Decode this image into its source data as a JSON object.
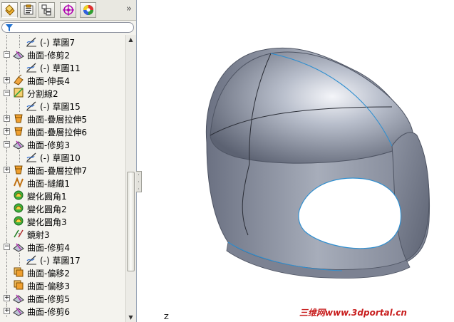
{
  "tabs": [
    {
      "name": "feature-manager-tab-icon",
      "active": true
    },
    {
      "name": "property-manager-tab-icon",
      "active": false
    },
    {
      "name": "configuration-manager-tab-icon",
      "active": false
    },
    {
      "name": "dim-xpert-tab-icon",
      "active": false
    },
    {
      "name": "display-manager-tab-icon",
      "active": false
    }
  ],
  "more_tabs_glyph": "»",
  "filter_icon": "filter-icon",
  "tree": {
    "items": [
      {
        "label": "(-) 草圖7",
        "indent": 2,
        "icon": "sketch-icon",
        "expander": ""
      },
      {
        "label": "曲面-修剪2",
        "indent": 1,
        "icon": "surface-trim-icon",
        "expander": "−"
      },
      {
        "label": "(-) 草圖11",
        "indent": 2,
        "icon": "sketch-icon",
        "expander": ""
      },
      {
        "label": "曲面-伸長4",
        "indent": 1,
        "icon": "surface-extend-icon",
        "expander": "+"
      },
      {
        "label": "分割線2",
        "indent": 1,
        "icon": "split-line-icon",
        "expander": "−"
      },
      {
        "label": "(-) 草圖15",
        "indent": 2,
        "icon": "sketch-icon",
        "expander": ""
      },
      {
        "label": "曲面-疊層拉伸5",
        "indent": 1,
        "icon": "surface-loft-icon",
        "expander": "+"
      },
      {
        "label": "曲面-疊層拉伸6",
        "indent": 1,
        "icon": "surface-loft-icon",
        "expander": "+"
      },
      {
        "label": "曲面-修剪3",
        "indent": 1,
        "icon": "surface-trim-icon",
        "expander": "−"
      },
      {
        "label": "(-) 草圖10",
        "indent": 2,
        "icon": "sketch-icon",
        "expander": ""
      },
      {
        "label": "曲面-疊層拉伸7",
        "indent": 1,
        "icon": "surface-loft-icon",
        "expander": "+"
      },
      {
        "label": "曲面-縫織1",
        "indent": 1,
        "icon": "surface-knit-icon",
        "expander": ""
      },
      {
        "label": "變化圓角1",
        "indent": 1,
        "icon": "variable-fillet-icon",
        "expander": ""
      },
      {
        "label": "變化圓角2",
        "indent": 1,
        "icon": "variable-fillet-icon",
        "expander": ""
      },
      {
        "label": "變化圓角3",
        "indent": 1,
        "icon": "variable-fillet-icon",
        "expander": ""
      },
      {
        "label": "鏡射3",
        "indent": 1,
        "icon": "mirror-icon",
        "expander": ""
      },
      {
        "label": "曲面-修剪4",
        "indent": 1,
        "icon": "surface-trim-icon",
        "expander": "−"
      },
      {
        "label": "(-) 草圖17",
        "indent": 2,
        "icon": "sketch-icon",
        "expander": ""
      },
      {
        "label": "曲面-偏移2",
        "indent": 1,
        "icon": "surface-offset-icon",
        "expander": ""
      },
      {
        "label": "曲面-偏移3",
        "indent": 1,
        "icon": "surface-offset-icon",
        "expander": ""
      },
      {
        "label": "曲面-修剪5",
        "indent": 1,
        "icon": "surface-trim-icon",
        "expander": "+"
      },
      {
        "label": "曲面-修剪6",
        "indent": 1,
        "icon": "surface-trim-icon",
        "expander": "+"
      }
    ]
  },
  "viewport": {
    "axis_label": "Z",
    "watermark": "三维网www.3dportal.cn",
    "model_color": "#a9afbd",
    "edge_color": "#2f8fd0"
  }
}
